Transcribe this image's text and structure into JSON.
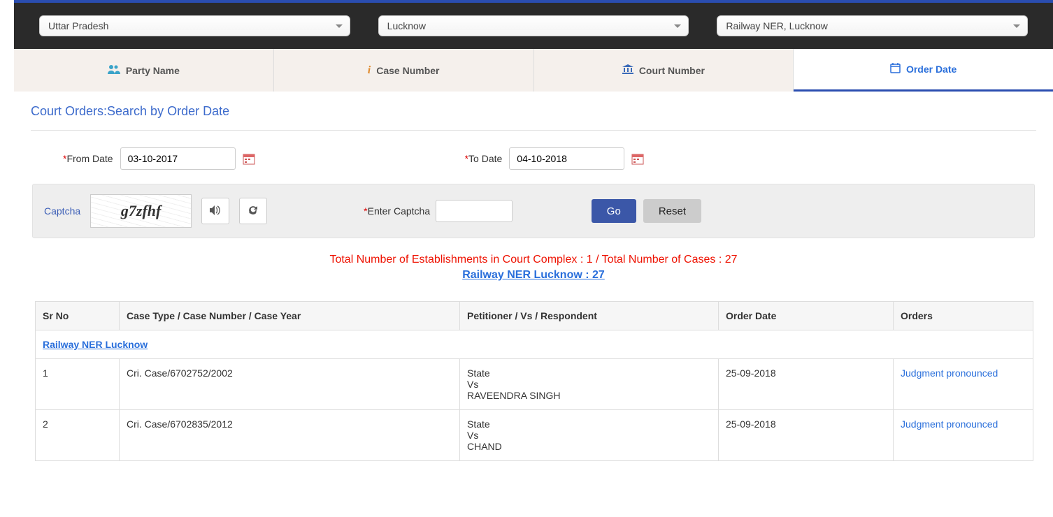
{
  "filters": {
    "state": "Uttar Pradesh",
    "city": "Lucknow",
    "complex": "Railway NER, Lucknow"
  },
  "tabs": {
    "party": "Party Name",
    "case": "Case Number",
    "court": "Court Number",
    "order": "Order Date"
  },
  "section_title": "Court Orders:Search by Order Date",
  "dates": {
    "from_label": "From Date",
    "from_value": "03-10-2017",
    "to_label": "To Date",
    "to_value": "04-10-2018"
  },
  "captcha": {
    "label": "Captcha",
    "image_text": "g7zfhf",
    "enter_label": "Enter Captcha",
    "input_value": "",
    "go": "Go",
    "reset": "Reset"
  },
  "summary": {
    "est_prefix": "Total Number of Establishments in Court Complex : ",
    "est_count": "1",
    "divider": "  /",
    "cases_prefix": " Total Number of Cases : ",
    "cases_count": "27",
    "link_text": "Railway NER Lucknow : 27"
  },
  "table": {
    "headers": {
      "srno": "Sr No",
      "case": "Case Type / Case Number / Case Year",
      "parties": "Petitioner / Vs / Respondent",
      "date": "Order Date",
      "orders": "Orders"
    },
    "group_label": "Railway NER Lucknow",
    "rows": [
      {
        "srno": "1",
        "case": "Cri. Case/6702752/2002",
        "parties": "State\nVs\nRAVEENDRA SINGH",
        "date": "25-09-2018",
        "order": "Judgment pronounced"
      },
      {
        "srno": "2",
        "case": "Cri. Case/6702835/2012",
        "parties": "State\nVs\nCHAND",
        "date": "25-09-2018",
        "order": "Judgment pronounced"
      }
    ]
  }
}
